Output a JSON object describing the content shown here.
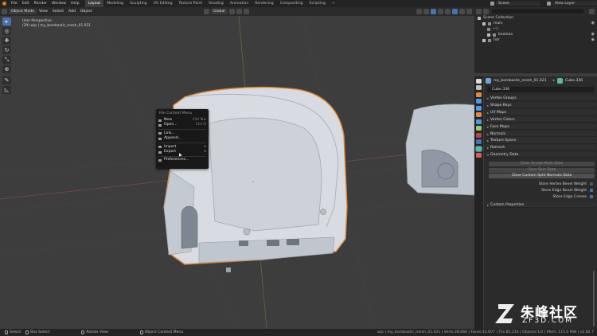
{
  "topbar": {
    "menus": [
      "File",
      "Edit",
      "Render",
      "Window",
      "Help"
    ],
    "workspaces": [
      "Layout",
      "Modeling",
      "Sculpting",
      "UV Editing",
      "Texture Paint",
      "Shading",
      "Animation",
      "Rendering",
      "Compositing",
      "Scripting"
    ],
    "active_workspace": "Layout",
    "add_tab": "+",
    "scene_label": "Scene",
    "view_layer_label": "View Layer"
  },
  "viewport_header": {
    "mode": "Object Mode",
    "menus": [
      "View",
      "Select",
      "Add",
      "Object"
    ],
    "orientation": "Global"
  },
  "viewport": {
    "label_line1": "User Perspective",
    "label_line2": "(29) wip | my_bombastic_mesh_01.021"
  },
  "toolbar": {
    "tools": [
      {
        "icon": "select-box-icon",
        "glyph": "▸",
        "active": true
      },
      {
        "icon": "cursor-icon",
        "glyph": "◎",
        "active": false
      },
      {
        "icon": "move-icon",
        "glyph": "✥",
        "active": false
      },
      {
        "icon": "rotate-icon",
        "glyph": "↻",
        "active": false
      },
      {
        "icon": "scale-icon",
        "glyph": "⤡",
        "active": false
      },
      {
        "icon": "transform-icon",
        "glyph": "⊕",
        "active": false
      },
      {
        "icon": "annotate-icon",
        "glyph": "✎",
        "active": false
      },
      {
        "icon": "measure-icon",
        "glyph": "◺",
        "active": false
      }
    ]
  },
  "context_menu": {
    "title": "File Context Menu",
    "items": [
      {
        "label": "New",
        "shortcut": "Ctrl N ▸",
        "sep_before": false
      },
      {
        "label": "Open...",
        "shortcut": "Ctrl O",
        "sep_before": false
      },
      {
        "label": "Link...",
        "shortcut": "",
        "sep_before": true
      },
      {
        "label": "Append...",
        "shortcut": "",
        "sep_before": false
      },
      {
        "label": "Import",
        "shortcut": "▸",
        "sep_before": true
      },
      {
        "label": "Export",
        "shortcut": "▸",
        "sep_before": false
      },
      {
        "label": "Preferences...",
        "shortcut": "",
        "sep_before": true
      }
    ]
  },
  "outliner": {
    "header": "Scene Collection",
    "rows": [
      {
        "label": "Scene Collection",
        "indent": 0,
        "checkbox": false,
        "eye": false
      },
      {
        "label": "main",
        "indent": 1,
        "checkbox": true,
        "eye": true
      },
      {
        "label": "wip",
        "indent": 2,
        "checkbox": false,
        "eye": false
      },
      {
        "label": "boolean",
        "indent": 2,
        "checkbox": true,
        "eye": true
      },
      {
        "label": "hdr",
        "indent": 1,
        "checkbox": true,
        "eye": true
      }
    ]
  },
  "properties": {
    "object_name": "my_bombastic_mesh_01.021",
    "data_name": "Cube.336",
    "name_field": "Cube.336",
    "panels": [
      "Vertex Groups",
      "Shape Keys",
      "UV Maps",
      "Vertex Colors",
      "Face Maps",
      "Normals",
      "Texture Space",
      "Remesh",
      "Geometry Data"
    ],
    "open_panel": "Geometry Data",
    "geometry_buttons": [
      {
        "label": "Clear Sculpt-Mask Data",
        "enabled": false
      },
      {
        "label": "Clear Skin Data",
        "enabled": false
      },
      {
        "label": "Clear Custom Split Normals Data",
        "enabled": true
      }
    ],
    "checkboxes": [
      {
        "label": "Store Vertex Bevel Weight",
        "checked": false
      },
      {
        "label": "Store Edge Bevel Weight",
        "checked": true
      },
      {
        "label": "Store Edge Crease",
        "checked": true
      }
    ],
    "custom_panel": "Custom Properties",
    "tab_colors": [
      "#d9d9d9",
      "#c0c0c0",
      "#e6873a",
      "#4d9ae8",
      "#4d9ae8",
      "#e6873a",
      "#4d9ae8",
      "#8fcf6f",
      "#bb4444",
      "#4772b3",
      "#55c08a",
      "#e05a5a"
    ]
  },
  "statusbar": {
    "items": [
      "Select",
      "Box Select",
      "Rotate View",
      "Object Context Menu"
    ],
    "stats": "wip | my_bombastic_mesh_01.021 | Verts:28,666 | Faces:42,607 | Tris:85,214 | Objects:1/2 | Mem: 115.0 MiB | v2.82.7"
  },
  "watermark": {
    "brand": "朱峰社区",
    "site": "ZF3D.COM"
  },
  "colors": {
    "selection_outline": "#e38430",
    "accent_blue": "#4772b3",
    "mesh_fill": "#d8dce2"
  }
}
